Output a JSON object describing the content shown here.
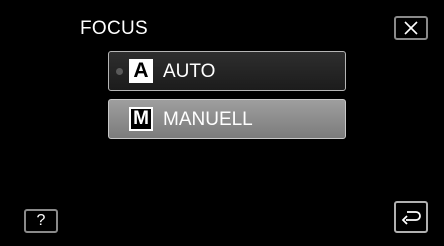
{
  "header": {
    "title": "FOCUS",
    "close_icon": "close-icon"
  },
  "options": [
    {
      "glyph": "A",
      "label": "AUTO",
      "selected": true
    },
    {
      "glyph": "M",
      "label": "MANUELL",
      "highlighted": true
    }
  ],
  "footer": {
    "help_label": "?",
    "back_icon": "return-arrow-icon"
  },
  "colors": {
    "background": "#000000",
    "option_normal": "#2a2a2a",
    "option_highlight": "#8c8c8c",
    "border": "#b5b5b5",
    "text": "#ffffff"
  }
}
